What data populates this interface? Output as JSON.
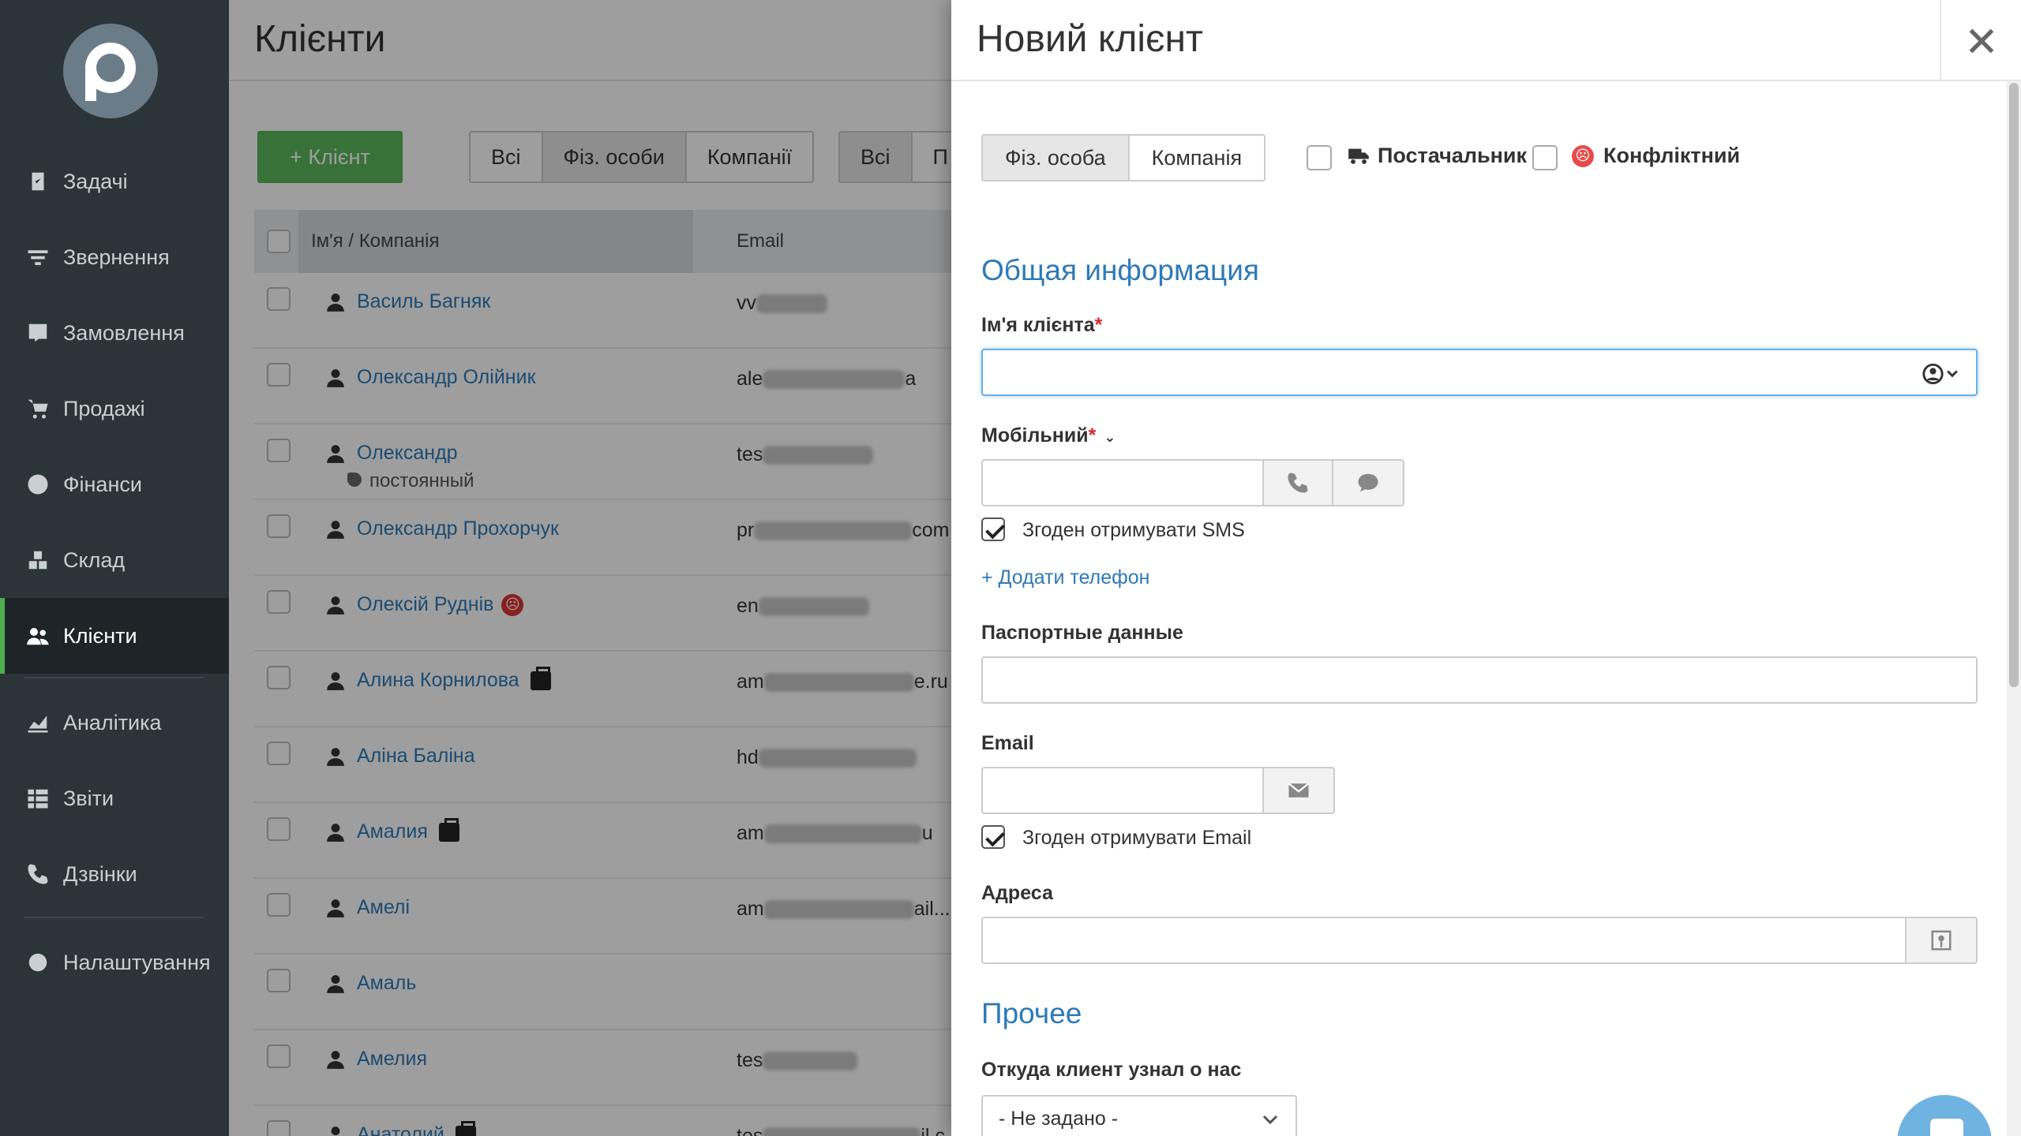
{
  "sidebar": {
    "items": [
      {
        "label": "Задачі",
        "icon": "task-icon"
      },
      {
        "label": "Звернення",
        "icon": "filter-icon"
      },
      {
        "label": "Замовлення",
        "icon": "order-icon"
      },
      {
        "label": "Продажі",
        "icon": "cart-icon"
      },
      {
        "label": "Фінанси",
        "icon": "dollar-icon"
      },
      {
        "label": "Склад",
        "icon": "boxes-icon"
      },
      {
        "label": "Клієнти",
        "icon": "users-icon",
        "active": true
      },
      {
        "label": "Аналітика",
        "icon": "chart-icon"
      },
      {
        "label": "Звіти",
        "icon": "list-icon"
      },
      {
        "label": "Дзвінки",
        "icon": "phone-icon"
      },
      {
        "label": "Налаштування",
        "icon": "gear-icon"
      }
    ]
  },
  "list": {
    "title": "Клієнти",
    "add_button": "+ Клієнт",
    "filter_type": [
      "Всі",
      "Фіз. особи",
      "Компанії"
    ],
    "filter_type_active": "Фіз. особи",
    "filter_second": [
      "Всі",
      "П"
    ],
    "columns": {
      "name": "Ім'я / Компанія",
      "email": "Email"
    },
    "rows": [
      {
        "name": "Василь Багняк",
        "email_prefix": "vv"
      },
      {
        "name": "Олександр Олійник",
        "email_prefix": "ale",
        "email_suffix": "a"
      },
      {
        "name": "Олександр",
        "sub": "постоянный",
        "email_prefix": "tes"
      },
      {
        "name": "Олександр Прохорчук",
        "email_prefix": "pr",
        "email_suffix": "com"
      },
      {
        "name": "Олексій Руднів",
        "badge": "conflict",
        "email_prefix": "en"
      },
      {
        "name": "Алина Корнилова",
        "badge": "supplier",
        "email_prefix": "am",
        "email_suffix": "e.ru"
      },
      {
        "name": "Аліна Баліна",
        "email_prefix": "hd"
      },
      {
        "name": "Амалия",
        "badge": "supplier",
        "email_prefix": "am",
        "email_suffix": "u"
      },
      {
        "name": "Амелі",
        "email_prefix": "am",
        "email_suffix": "ail...."
      },
      {
        "name": "Амаль",
        "email_prefix": ""
      },
      {
        "name": "Амелия",
        "email_prefix": "tes"
      },
      {
        "name": "Анатолий",
        "badge": "supplier",
        "email_prefix": "tes",
        "email_suffix": "il.c"
      }
    ]
  },
  "modal": {
    "title": "Новий клієнт",
    "type_options": [
      "Фіз. особа",
      "Компанія"
    ],
    "type_active": "Фіз. особа",
    "supplier_label": "Постачальник",
    "conflict_label": "Конфліктний",
    "section_general": "Общая информация",
    "name_label": "Ім'я клієнта",
    "name_value": "",
    "mobile_label": "Мобільний",
    "mobile_value": "",
    "sms_consent": "Згоден отримувати SMS",
    "sms_checked": true,
    "add_phone": "+ Додати телефон",
    "passport_label": "Паспортные данные",
    "passport_value": "",
    "email_label": "Email",
    "email_value": "",
    "email_consent": "Згоден отримувати Email",
    "email_checked": true,
    "address_label": "Адреса",
    "address_value": "",
    "section_other": "Прочее",
    "source_label": "Откуда клиент узнал о нас",
    "source_value": "- Не задано -",
    "required_mark": "*"
  }
}
